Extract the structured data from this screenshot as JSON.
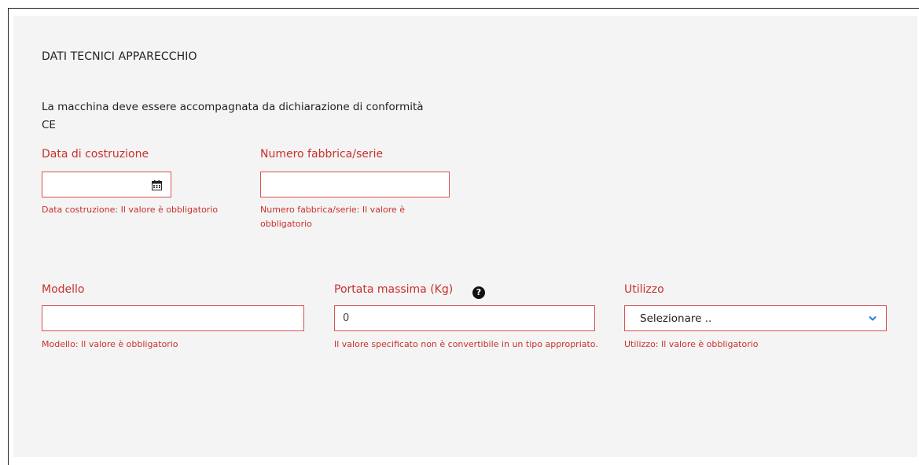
{
  "section": {
    "title": "DATI TECNICI APPARECCHIO",
    "notice": "La macchina deve essere accompagnata da dichiarazione di conformità CE"
  },
  "fields": {
    "data_costruzione": {
      "label": "Data di costruzione",
      "value": "",
      "error": "Data costruzione: Il valore è obbligatorio",
      "icon": "calendar-icon"
    },
    "numero_fabbrica": {
      "label": "Numero fabbrica/serie",
      "value": "",
      "error": "Numero fabbrica/serie: Il valore è obbligatorio"
    },
    "modello": {
      "label": "Modello",
      "value": "",
      "error": "Modello: Il valore è obbligatorio"
    },
    "portata_massima": {
      "label": "Portata massima (Kg)",
      "value": "0",
      "error": "Il valore specificato non è convertibile in un tipo appropriato.",
      "help_icon": "question-circle-icon",
      "help_glyph": "?"
    },
    "utilizzo": {
      "label": "Utilizzo",
      "selected": "Selezionare ..",
      "error": "Utilizzo: Il valore è obbligatorio",
      "icon": "chevron-down-icon"
    }
  },
  "colors": {
    "error": "#c9302c",
    "border_error": "#d9534f",
    "panel_bg": "#f4f4f4",
    "accent": "#2a7fd4"
  }
}
